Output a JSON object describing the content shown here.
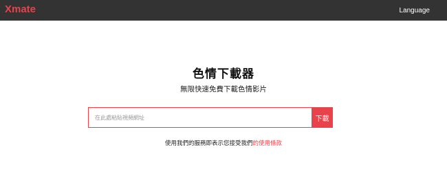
{
  "header": {
    "logo": "Xmate",
    "language_label": "Language"
  },
  "hero": {
    "title": "色情下載器",
    "subtitle": "無限快速免費下載色情影片"
  },
  "search": {
    "placeholder": "在此處粘貼視頻網址",
    "button_label": "下載"
  },
  "terms": {
    "prefix": "使用我們的服務即表示您接受我們",
    "link_text": "的使用條款"
  },
  "colors": {
    "accent": "#e8434b",
    "navbar": "#333333"
  }
}
